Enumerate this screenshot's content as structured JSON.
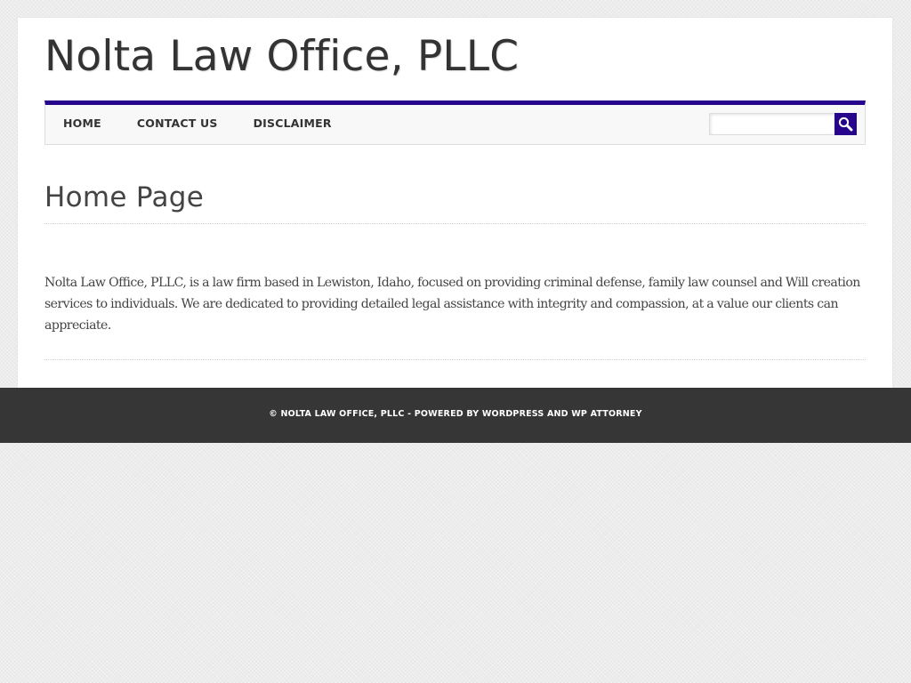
{
  "site": {
    "title": "Nolta Law Office, PLLC"
  },
  "nav": {
    "items": [
      {
        "label": "HOME"
      },
      {
        "label": "CONTACT US"
      },
      {
        "label": "DISCLAIMER"
      }
    ]
  },
  "search": {
    "value": "",
    "placeholder": "",
    "button_icon": "search-icon"
  },
  "main": {
    "page_title": "Home Page",
    "body": "Nolta Law Office, PLLC, is a law firm based in Lewiston, Idaho, focused on providing criminal defense, family law counsel and Will creation services to individuals. We are dedicated to providing detailed legal assistance with integrity and compassion, at a value our clients can appreciate."
  },
  "footer": {
    "text": "© NOLTA LAW OFFICE, PLLC - POWERED BY WORDPRESS AND WP ATTORNEY"
  },
  "colors": {
    "accent": "#26048c",
    "footer_bg": "#363636",
    "page_bg": "#ececec",
    "text": "#444444"
  }
}
